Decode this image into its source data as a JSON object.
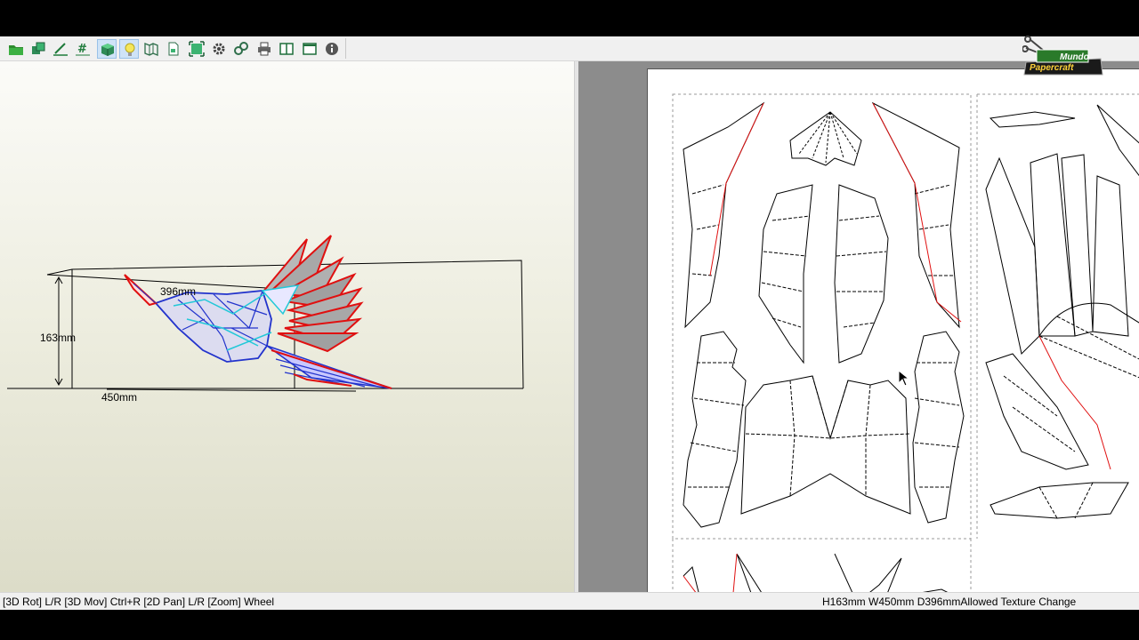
{
  "toolbar": {
    "buttons": [
      {
        "name": "open-folder-icon",
        "active": false
      },
      {
        "name": "3d-parts-icon",
        "active": false
      },
      {
        "name": "edit-line-icon",
        "active": false
      },
      {
        "name": "grid-icon",
        "active": false
      },
      {
        "name": "cube-icon",
        "active": true
      },
      {
        "name": "lightbulb-icon",
        "active": true
      },
      {
        "name": "map-icon",
        "active": false
      },
      {
        "name": "page-icon",
        "active": false
      },
      {
        "name": "fit-view-icon",
        "active": false
      },
      {
        "name": "gear-icon",
        "active": false
      },
      {
        "name": "link-icon",
        "active": false
      },
      {
        "name": "print-icon",
        "active": false
      },
      {
        "name": "split-view-icon",
        "active": false
      },
      {
        "name": "window-icon",
        "active": false
      },
      {
        "name": "info-icon",
        "active": false
      }
    ]
  },
  "view3d": {
    "dimensions": {
      "depth": "396mm",
      "height": "163mm",
      "width": "450mm"
    }
  },
  "statusbar": {
    "left": "[3D Rot] L/R [3D Mov] Ctrl+R [2D Pan] L/R [Zoom] Wheel",
    "right": "H163mm W450mm D396mmAllowed Texture Change"
  },
  "logo": {
    "line1": "Mundo",
    "line2": "Papercraft"
  },
  "colors": {
    "cut": "#e01010",
    "mountain": "#2233cc",
    "valley": "#22c8d8",
    "active": "#cfe3f7"
  }
}
